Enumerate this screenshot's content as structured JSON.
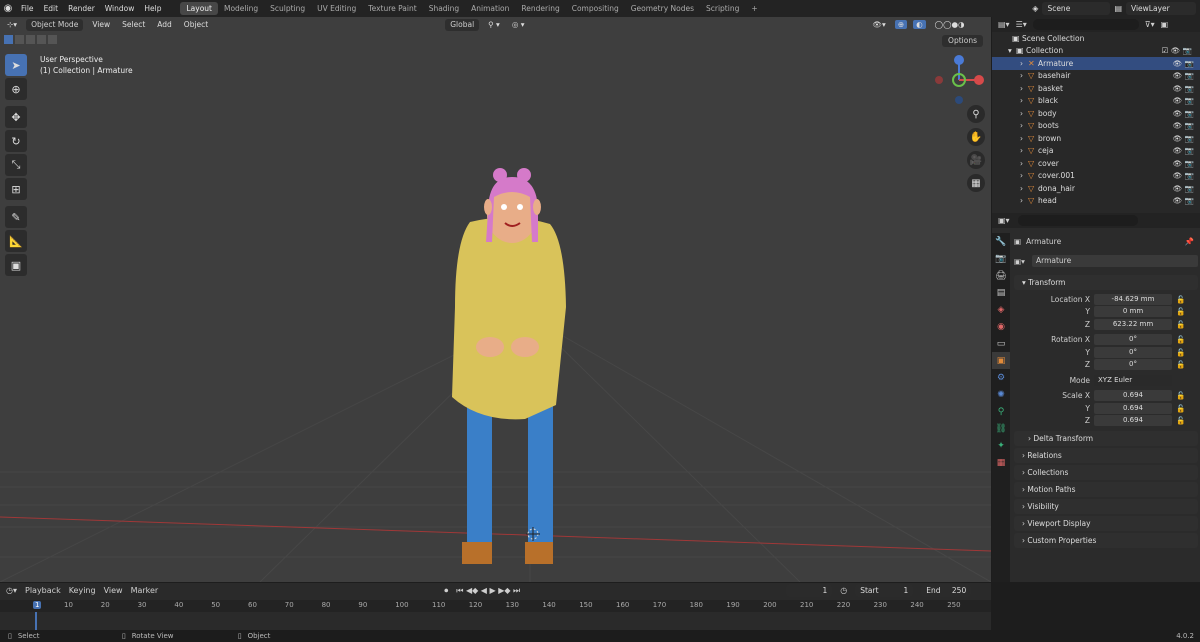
{
  "menu": {
    "items": [
      "File",
      "Edit",
      "Render",
      "Window",
      "Help"
    ]
  },
  "workspaces": [
    "Layout",
    "Modeling",
    "Sculpting",
    "UV Editing",
    "Texture Paint",
    "Shading",
    "Animation",
    "Rendering",
    "Compositing",
    "Geometry Nodes",
    "Scripting"
  ],
  "active_workspace": "Layout",
  "scene": {
    "name": "Scene",
    "view_layer": "ViewLayer"
  },
  "viewport": {
    "mode": "Object Mode",
    "menus": [
      "View",
      "Select",
      "Add",
      "Object"
    ],
    "transform": "Global",
    "options": "Options",
    "perspective": "User Perspective",
    "context": "(1) Collection | Armature"
  },
  "outliner": {
    "root": "Scene Collection",
    "collection": "Collection",
    "items": [
      "Armature",
      "basehair",
      "basket",
      "black",
      "body",
      "boots",
      "brown",
      "ceja",
      "cover",
      "cover.001",
      "dona_hair",
      "head"
    ]
  },
  "properties": {
    "object": "Armature",
    "data": "Armature",
    "transform": "Transform",
    "location": {
      "label": "Location X",
      "x": "-84.629 mm",
      "y": "0 mm",
      "z": "623.22 mm"
    },
    "rotation": {
      "label": "Rotation X",
      "x": "0°",
      "y": "0°",
      "z": "0°"
    },
    "mode_label": "Mode",
    "mode": "XYZ Euler",
    "scale": {
      "label": "Scale X",
      "x": "0.694",
      "y": "0.694",
      "z": "0.694"
    },
    "y_label": "Y",
    "z_label": "Z",
    "delta": "Delta Transform",
    "panels": [
      "Relations",
      "Collections",
      "Motion Paths",
      "Visibility",
      "Viewport Display",
      "Custom Properties"
    ]
  },
  "timeline": {
    "menus": [
      "Playback",
      "Keying",
      "View",
      "Marker"
    ],
    "current": "1",
    "start_label": "Start",
    "start": "1",
    "end_label": "End",
    "end": "250",
    "ticks": [
      "1",
      "10",
      "20",
      "30",
      "40",
      "50",
      "60",
      "70",
      "80",
      "90",
      "100",
      "110",
      "120",
      "130",
      "140",
      "150",
      "160",
      "170",
      "180",
      "190",
      "200",
      "210",
      "220",
      "230",
      "240",
      "250"
    ]
  },
  "status": {
    "select": "Select",
    "rotate": "Rotate View",
    "object": "Object",
    "version": "4.0.2"
  },
  "colors": {
    "accent": "#4772b3",
    "selected_row": "#334d80",
    "grid_red": "#a03838"
  }
}
